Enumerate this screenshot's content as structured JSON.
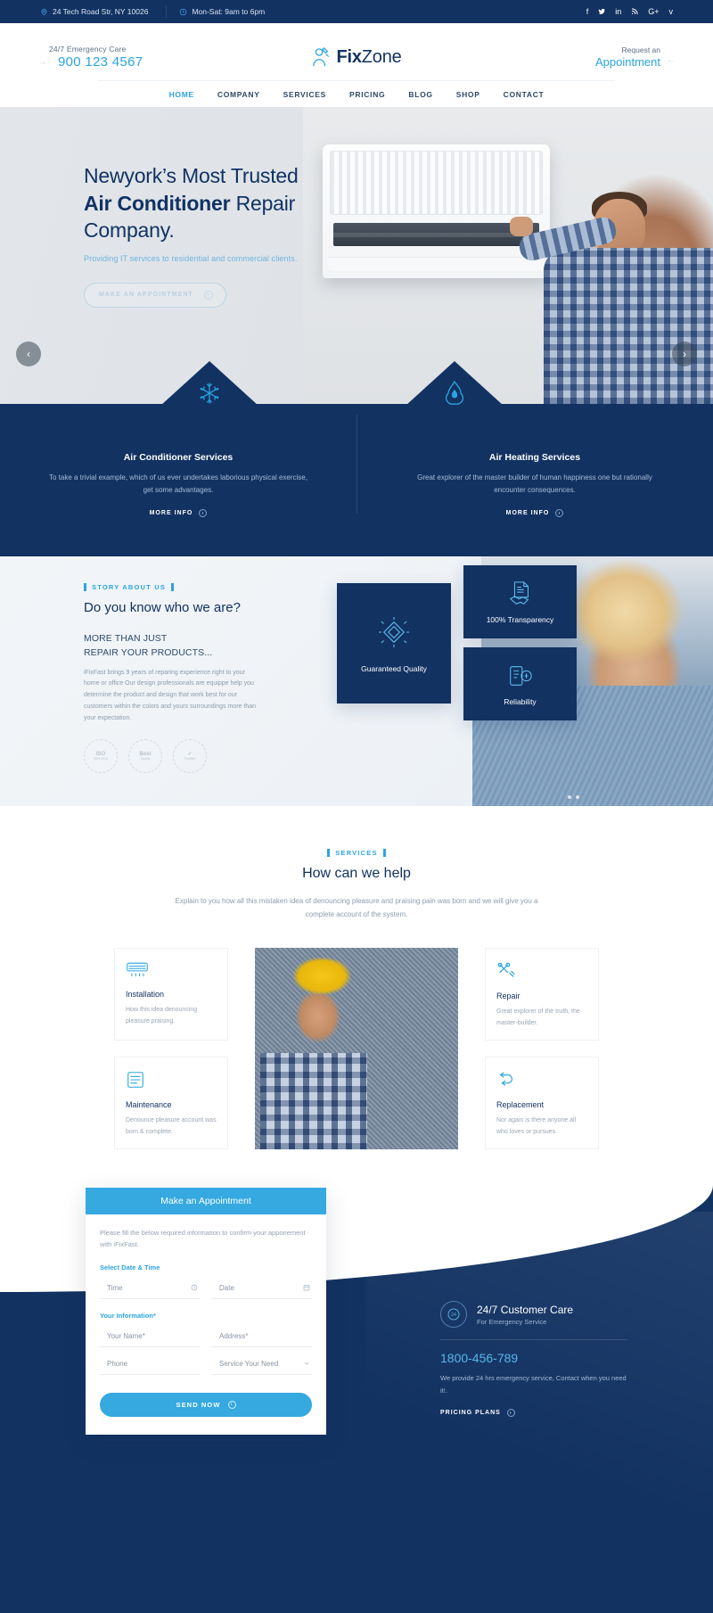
{
  "topbar": {
    "address": "24 Tech Road Str, NY 10026",
    "address_icon": "map-pin-icon",
    "hours": "Mon-Sat: 9am to 6pm",
    "hours_icon": "clock-icon",
    "social": [
      {
        "name": "facebook-icon",
        "glyph": "f"
      },
      {
        "name": "twitter-icon",
        "glyph": "ᴠ"
      },
      {
        "name": "linkedin-icon",
        "glyph": "in"
      },
      {
        "name": "rss-icon",
        "glyph": "⦀"
      },
      {
        "name": "google-plus-icon",
        "glyph": "G+"
      },
      {
        "name": "vimeo-icon",
        "glyph": "v"
      }
    ]
  },
  "header": {
    "emergency_label": "24/7 Emergency Care",
    "emergency_phone": "900 123 4567",
    "brand_first": "Fix",
    "brand_second": "Zone",
    "request_label": "Request an",
    "request_link": "Appointment"
  },
  "nav": {
    "items": [
      {
        "label": "HOME",
        "active": true
      },
      {
        "label": "COMPANY",
        "active": false
      },
      {
        "label": "SERVICES",
        "active": false
      },
      {
        "label": "PRICING",
        "active": false
      },
      {
        "label": "BLOG",
        "active": false
      },
      {
        "label": "SHOP",
        "active": false
      },
      {
        "label": "CONTACT",
        "active": false
      }
    ]
  },
  "hero": {
    "title_line1": "Newyork’s Most Trusted",
    "title_strong": "Air Conditioner",
    "title_after": " Repair",
    "title_line3": "Company.",
    "subtitle": "Providing IT services to residential and commercial clients.",
    "cta_label": "MAKE AN APPOINTMENT",
    "prev_label": "‹",
    "next_label": "›"
  },
  "service_banner": {
    "columns": [
      {
        "icon": "snowflake-icon",
        "title": "Air Conditioner Services",
        "text": "To take a trivial example, which of us ever undertakes laborious physical exercise, get some advantages.",
        "link": "MORE INFO"
      },
      {
        "icon": "flame-icon",
        "title": "Air Heating Services",
        "text": "Great explorer of the master builder of human happiness one but rationally encounter consequences.",
        "link": "MORE INFO"
      }
    ]
  },
  "about": {
    "eyebrow": "STORY ABOUT US",
    "heading": "Do you know who we are?",
    "subheading_line1": "MORE THAN JUST",
    "subheading_line2": "REPAIR YOUR PRODUCTS...",
    "body": "iFixFast brings 9 years of reparing experience right to your home or office Our design professionals are equippe help you determine the product and design that work best for our customers within the colors and yours surroundings more than your expectation.",
    "badges": [
      {
        "name": "iso-badge",
        "label": "ISO",
        "sub": "9001:2015"
      },
      {
        "name": "quality-badge",
        "label": "Best",
        "sub": "Quality"
      },
      {
        "name": "verified-badge",
        "label": "✓",
        "sub": "Certified"
      }
    ],
    "features": [
      {
        "icon": "diamond-quality-icon",
        "label": "Guaranteed Quality"
      },
      {
        "icon": "document-handshake-icon",
        "label": "100% Transparency"
      },
      {
        "icon": "reliability-icon",
        "label": "Reliability"
      }
    ]
  },
  "services": {
    "eyebrow": "SERVICES",
    "heading": "How can we help",
    "lead": "Explain to you how all this mistaken idea of denouncing pleasure and praising pain was born and we will give you a complete account of the system.",
    "left_cards": [
      {
        "icon": "ac-unit-icon",
        "title": "Installation",
        "text": "How this idea denouncing pleasure praising."
      },
      {
        "icon": "maintenance-icon",
        "title": "Maintenance",
        "text": "Denounce pleasure account was born & complete."
      }
    ],
    "right_cards": [
      {
        "icon": "tools-icon",
        "title": "Repair",
        "text": "Great explorer of the truth, the master-builder."
      },
      {
        "icon": "replacement-icon",
        "title": "Replacement",
        "text": "Nor again is there anyone all who loves or pursues."
      }
    ]
  },
  "appointment": {
    "form_title": "Make an Appointment",
    "note": "Please fill the below required information to confirm your apponement with iFixFast.",
    "group1_label": "Select Date & Time",
    "time_placeholder": "Time",
    "time_icon": "clock-icon",
    "date_placeholder": "Date",
    "date_icon": "calendar-icon",
    "group2_label": "Your Information*",
    "name_placeholder": "Your Name*",
    "address_placeholder": "Address*",
    "phone_placeholder": "Phone",
    "service_placeholder": "Service Your Need",
    "service_icon": "chevron-down-icon",
    "submit_label": "SEND NOW"
  },
  "care": {
    "icon": "24h-support-icon",
    "title": "24/7 Customer Care",
    "subtitle": "For Emergency Service",
    "phone": "1800-456-789",
    "description": "We provide 24 hrs emergency service, Contact when you need it!.",
    "link": "PRICING PLANS"
  },
  "colors": {
    "navy": "#123262",
    "accent": "#2ba4e0",
    "light_accent": "#35a9e0",
    "muted": "#8d9cae"
  }
}
